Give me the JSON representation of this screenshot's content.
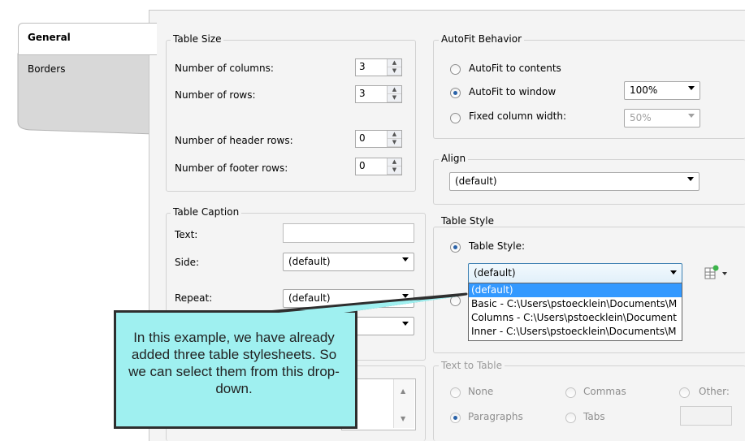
{
  "tabs": [
    {
      "label": "General"
    },
    {
      "label": "Borders"
    }
  ],
  "table_size": {
    "title": "Table Size",
    "columns_label": "Number of columns:",
    "columns_value": "3",
    "rows_label": "Number of rows:",
    "rows_value": "3",
    "header_rows_label": "Number of header rows:",
    "header_rows_value": "0",
    "footer_rows_label": "Number of footer rows:",
    "footer_rows_value": "0"
  },
  "autofit": {
    "title": "AutoFit Behavior",
    "contents_label": "AutoFit to contents",
    "window_label": "AutoFit to window",
    "window_value": "100%",
    "fixed_label": "Fixed column width:",
    "fixed_value": "50%"
  },
  "align": {
    "title": "Align",
    "value": "(default)"
  },
  "caption": {
    "title": "Table Caption",
    "text_label": "Text:",
    "text_value": "",
    "side_label": "Side:",
    "side_value": "(default)",
    "repeat_label": "Repeat:",
    "repeat_value": "(default)"
  },
  "table_style": {
    "title": "Table Style",
    "radio_label": "Table Style:",
    "value": "(default)",
    "options": [
      "(default)",
      "Basic - C:\\Users\\pstoecklein\\Documents\\M",
      "Columns - C:\\Users\\pstoecklein\\Document",
      "Inner - C:\\Users\\pstoecklein\\Documents\\M"
    ]
  },
  "text_to_table": {
    "title": "Text to Table",
    "none_label": "None",
    "commas_label": "Commas",
    "other_label": "Other:",
    "paragraphs_label": "Paragraphs",
    "tabs_label": "Tabs"
  },
  "callout": {
    "text": "In this example, we have already added three table stylesheets. So we can select them from this drop-down."
  },
  "colors": {
    "callout_fill": "#9ff0f0",
    "selection": "#3399ff"
  }
}
